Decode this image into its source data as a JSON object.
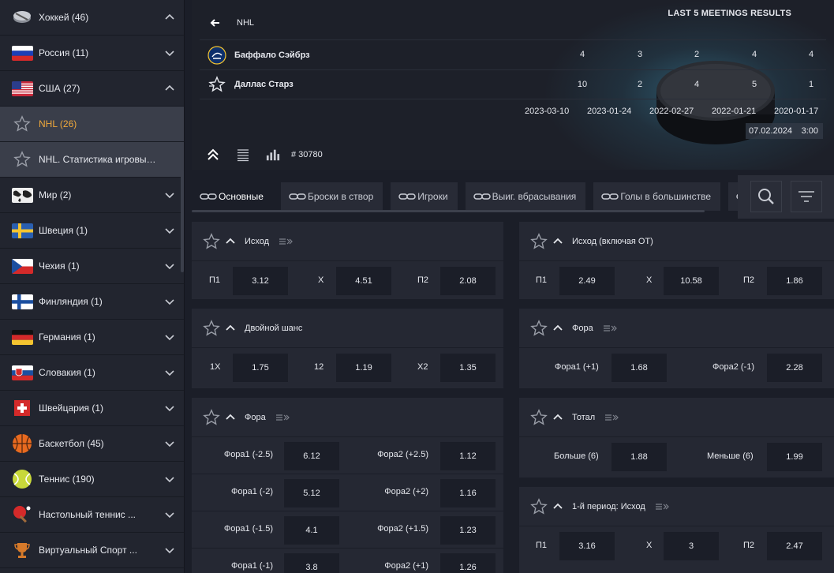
{
  "sidebar": {
    "items": [
      {
        "label": "Хоккей (46)",
        "icon": "hockey-puck-icon",
        "expanded": true
      },
      {
        "label": "Россия (11)",
        "icon": "russia-flag-icon"
      },
      {
        "label": "США (27)",
        "icon": "usa-flag-icon",
        "expanded": true
      },
      {
        "label": "NHL (26)",
        "icon": "star-icon",
        "active": true
      },
      {
        "label": "NHL. Статистика игровых...",
        "icon": "star-icon"
      },
      {
        "label": "Мир (2)",
        "icon": "world-map-icon"
      },
      {
        "label": "Швеция (1)",
        "icon": "sweden-flag-icon"
      },
      {
        "label": "Чехия (1)",
        "icon": "czech-flag-icon"
      },
      {
        "label": "Финляндия (1)",
        "icon": "finland-flag-icon"
      },
      {
        "label": "Германия (1)",
        "icon": "germany-flag-icon"
      },
      {
        "label": "Словакия (1)",
        "icon": "slovakia-flag-icon"
      },
      {
        "label": "Швейцария (1)",
        "icon": "switzerland-flag-icon"
      },
      {
        "label": "Баскетбол (45)",
        "icon": "basketball-icon"
      },
      {
        "label": "Теннис (190)",
        "icon": "tennis-ball-icon"
      },
      {
        "label": "Настольный теннис ...",
        "icon": "table-tennis-icon"
      },
      {
        "label": "Виртуальный Спорт ...",
        "icon": "trophy-icon"
      }
    ]
  },
  "header": {
    "league": "NHL",
    "meetings_title": "LAST 5 MEETINGS RESULTS",
    "teams": [
      {
        "name": "Баффало Сэйбрз",
        "logo": "buffalo-sabres-logo-icon",
        "scores": [
          "4",
          "3",
          "2",
          "4",
          "4"
        ]
      },
      {
        "name": "Даллас Старз",
        "logo": "dallas-stars-logo-icon",
        "scores": [
          "10",
          "2",
          "4",
          "5",
          "1"
        ]
      }
    ],
    "dates": [
      "2023-03-10",
      "2023-01-24",
      "2022-02-27",
      "2022-01-21",
      "2020-01-17"
    ],
    "match_date": "07.02.2024",
    "match_time": "3:00",
    "game_id": "# 30780"
  },
  "tabs": [
    {
      "label": "Основные",
      "active": true
    },
    {
      "label": "Броски в створ"
    },
    {
      "label": "Игроки"
    },
    {
      "label": "Выиг. вбрасывания"
    },
    {
      "label": "Голы в большинстве"
    },
    {
      "label": ""
    }
  ],
  "markets": {
    "outcome": {
      "title": "Исход",
      "odds": [
        {
          "label": "П1",
          "value": "3.12"
        },
        {
          "label": "Х",
          "value": "4.51"
        },
        {
          "label": "П2",
          "value": "2.08"
        }
      ]
    },
    "outcome_ot": {
      "title": "Исход (включая ОТ)",
      "odds": [
        {
          "label": "П1",
          "value": "2.49"
        },
        {
          "label": "Х",
          "value": "10.58"
        },
        {
          "label": "П2",
          "value": "1.86"
        }
      ]
    },
    "double_chance": {
      "title": "Двойной шанс",
      "odds": [
        {
          "label": "1Х",
          "value": "1.75"
        },
        {
          "label": "12",
          "value": "1.19"
        },
        {
          "label": "Х2",
          "value": "1.35"
        }
      ]
    },
    "handicap_right": {
      "title": "Фора",
      "odds": [
        {
          "label": "Фора1 (+1)",
          "value": "1.68"
        },
        {
          "label": "Фора2 (-1)",
          "value": "2.28"
        }
      ]
    },
    "handicap_left": {
      "title": "Фора",
      "rows": [
        [
          {
            "label": "Фора1 (-2.5)",
            "value": "6.12"
          },
          {
            "label": "Фора2 (+2.5)",
            "value": "1.12"
          }
        ],
        [
          {
            "label": "Фора1 (-2)",
            "value": "5.12"
          },
          {
            "label": "Фора2 (+2)",
            "value": "1.16"
          }
        ],
        [
          {
            "label": "Фора1 (-1.5)",
            "value": "4.1"
          },
          {
            "label": "Фора2 (+1.5)",
            "value": "1.23"
          }
        ],
        [
          {
            "label": "Фора1 (-1)",
            "value": "3.8"
          },
          {
            "label": "Фора2 (+1)",
            "value": "1.26"
          }
        ]
      ]
    },
    "total": {
      "title": "Тотал",
      "odds": [
        {
          "label": "Больше (6)",
          "value": "1.88"
        },
        {
          "label": "Меньше (6)",
          "value": "1.99"
        }
      ]
    },
    "period1": {
      "title": "1-й период: Исход",
      "odds": [
        {
          "label": "П1",
          "value": "3.16"
        },
        {
          "label": "Х",
          "value": "3"
        },
        {
          "label": "П2",
          "value": "2.47"
        }
      ]
    }
  },
  "colors": {
    "active_accent": "#f0a93b",
    "background": "#1b1e28",
    "card": "#252833"
  }
}
